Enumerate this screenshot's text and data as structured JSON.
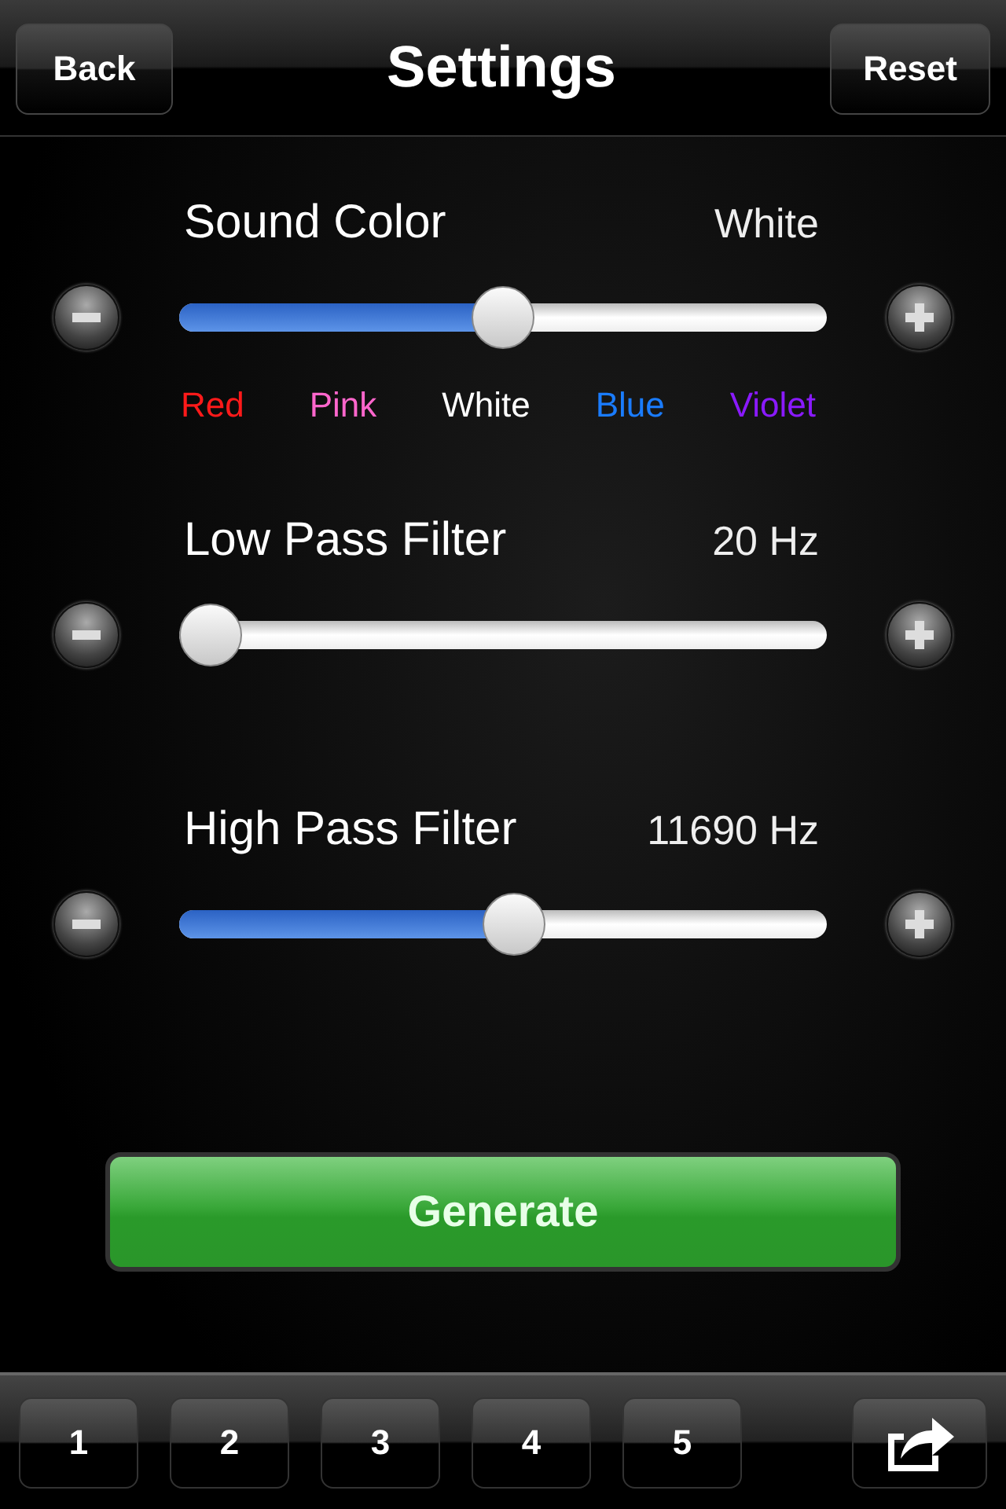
{
  "nav_bar": {
    "back": "Back",
    "title": "Settings",
    "reset": "Reset"
  },
  "sound_color": {
    "label": "Sound Color",
    "value": "White",
    "level": 0.5,
    "colors": [
      {
        "name": "Red",
        "color": "#ff1a1a"
      },
      {
        "name": "Pink",
        "color": "#ff66cc"
      },
      {
        "name": "White",
        "color": "#ffffff"
      },
      {
        "name": "Blue",
        "color": "#1a7cff"
      },
      {
        "name": "Violet",
        "color": "#8a1aff"
      }
    ]
  },
  "filters": [
    {
      "label": "Low Pass Filter",
      "value": "20 Hz",
      "level": 0
    },
    {
      "label": "High Pass Filter",
      "value": "11690 Hz",
      "level": 0.52
    }
  ],
  "generate_button": "Generate",
  "presets": [
    "1",
    "2",
    "3",
    "4",
    "5"
  ]
}
